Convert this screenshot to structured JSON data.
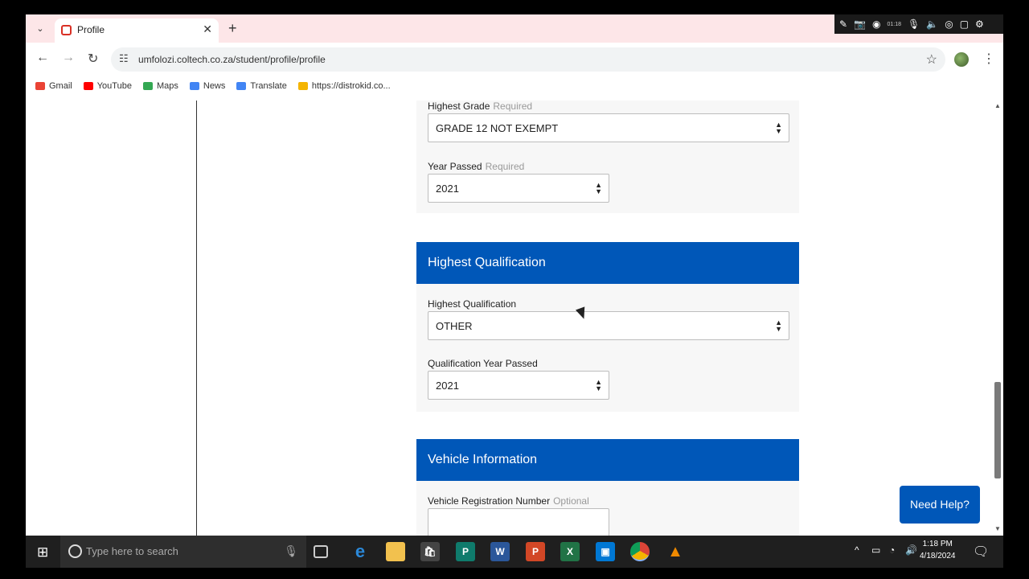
{
  "browser": {
    "tab_title": "Profile",
    "url": "umfolozi.coltech.co.za/student/profile/profile",
    "bookmarks": [
      {
        "label": "Gmail",
        "icon": "gmail-icon",
        "color": "#ea4335"
      },
      {
        "label": "YouTube",
        "icon": "youtube-icon",
        "color": "#ff0000"
      },
      {
        "label": "Maps",
        "icon": "maps-icon",
        "color": "#34a853"
      },
      {
        "label": "News",
        "icon": "news-icon",
        "color": "#4285f4"
      },
      {
        "label": "Translate",
        "icon": "translate-icon",
        "color": "#4285f4"
      },
      {
        "label": "https://distrokid.co...",
        "icon": "distrokid-icon",
        "color": "#f4b400"
      }
    ],
    "recorder_time": "01:18"
  },
  "form": {
    "highest_grade": {
      "label": "Highest Grade",
      "hint": "Required",
      "value": "GRADE 12 NOT EXEMPT"
    },
    "year_passed": {
      "label": "Year Passed",
      "hint": "Required",
      "value": "2021"
    },
    "qualification_section": {
      "title": "Highest Qualification"
    },
    "highest_qualification": {
      "label": "Highest Qualification",
      "value": "OTHER"
    },
    "qualification_year": {
      "label": "Qualification Year Passed",
      "value": "2021"
    },
    "vehicle_section": {
      "title": "Vehicle Information"
    },
    "vehicle_reg": {
      "label": "Vehicle Registration Number",
      "hint": "Optional",
      "value": ""
    }
  },
  "help_button": "Need Help?",
  "taskbar": {
    "search_placeholder": "Type here to search",
    "time": "1:18 PM",
    "date": "4/18/2024"
  },
  "colors": {
    "accent": "#0057b8",
    "tab_strip": "#fde6e8"
  }
}
